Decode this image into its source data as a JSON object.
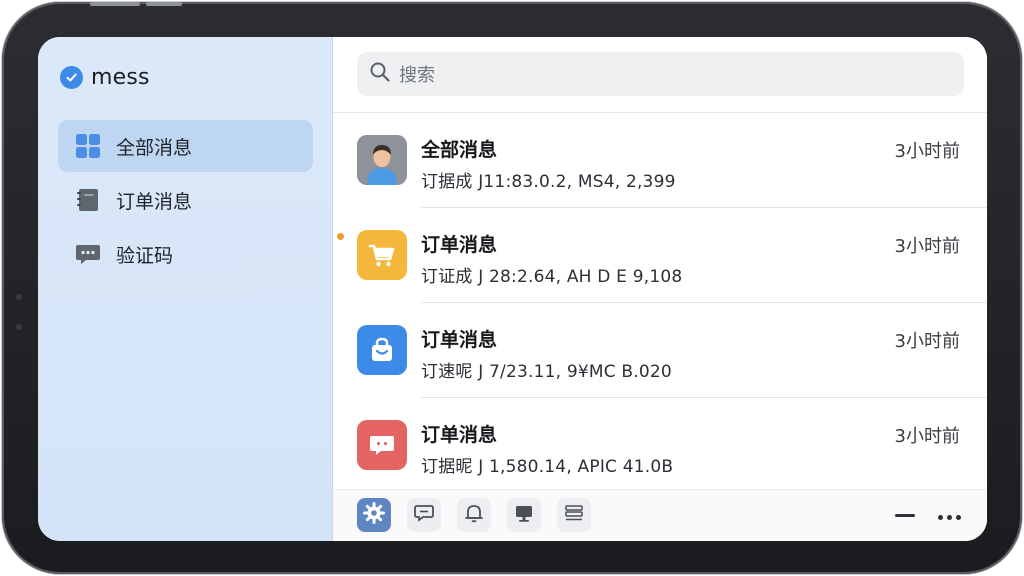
{
  "app": {
    "title": "mess"
  },
  "sidebar": {
    "items": [
      {
        "label": "全部消息",
        "icon": "grid-icon",
        "active": true
      },
      {
        "label": "订单消息",
        "icon": "notebook-icon",
        "active": false
      },
      {
        "label": "验证码",
        "icon": "chat-bubble-icon",
        "active": false
      }
    ]
  },
  "search": {
    "placeholder": "搜索"
  },
  "messages": [
    {
      "title": "全部消息",
      "preview": "订据成 J11:83.0.2, MS4, 2,399",
      "time": "3小时前",
      "icon": "person-avatar-icon",
      "color": "#8c8f96",
      "unread": false
    },
    {
      "title": "订单消息",
      "preview": "订证成 J 28:2.64, AH D E 9,108",
      "time": "3小时前",
      "icon": "cart-icon",
      "color": "#f5b63c",
      "unread": true
    },
    {
      "title": "订单消息",
      "preview": "订速呢 J 7/23.11, 9¥MC B.020",
      "time": "3小时前",
      "icon": "shopping-bag-icon",
      "color": "#3d8be8",
      "unread": false
    },
    {
      "title": "订单消息",
      "preview": "订据昵 J 1,580.14, APIC 41.0B",
      "time": "3小时前",
      "icon": "message-icon",
      "color": "#e46363",
      "unread": false
    }
  ],
  "toolbar": {
    "tools": [
      "gear-icon",
      "chat-icon",
      "bell-icon",
      "monitor-icon",
      "list-icon"
    ],
    "extra": [
      "minus-icon",
      "more-icon"
    ]
  },
  "colors": {
    "accent": "#3d8be8",
    "sidebar_bg": "#d4e4f8",
    "sidebar_active": "#bfd6f3",
    "unread": "#f39a2e"
  }
}
